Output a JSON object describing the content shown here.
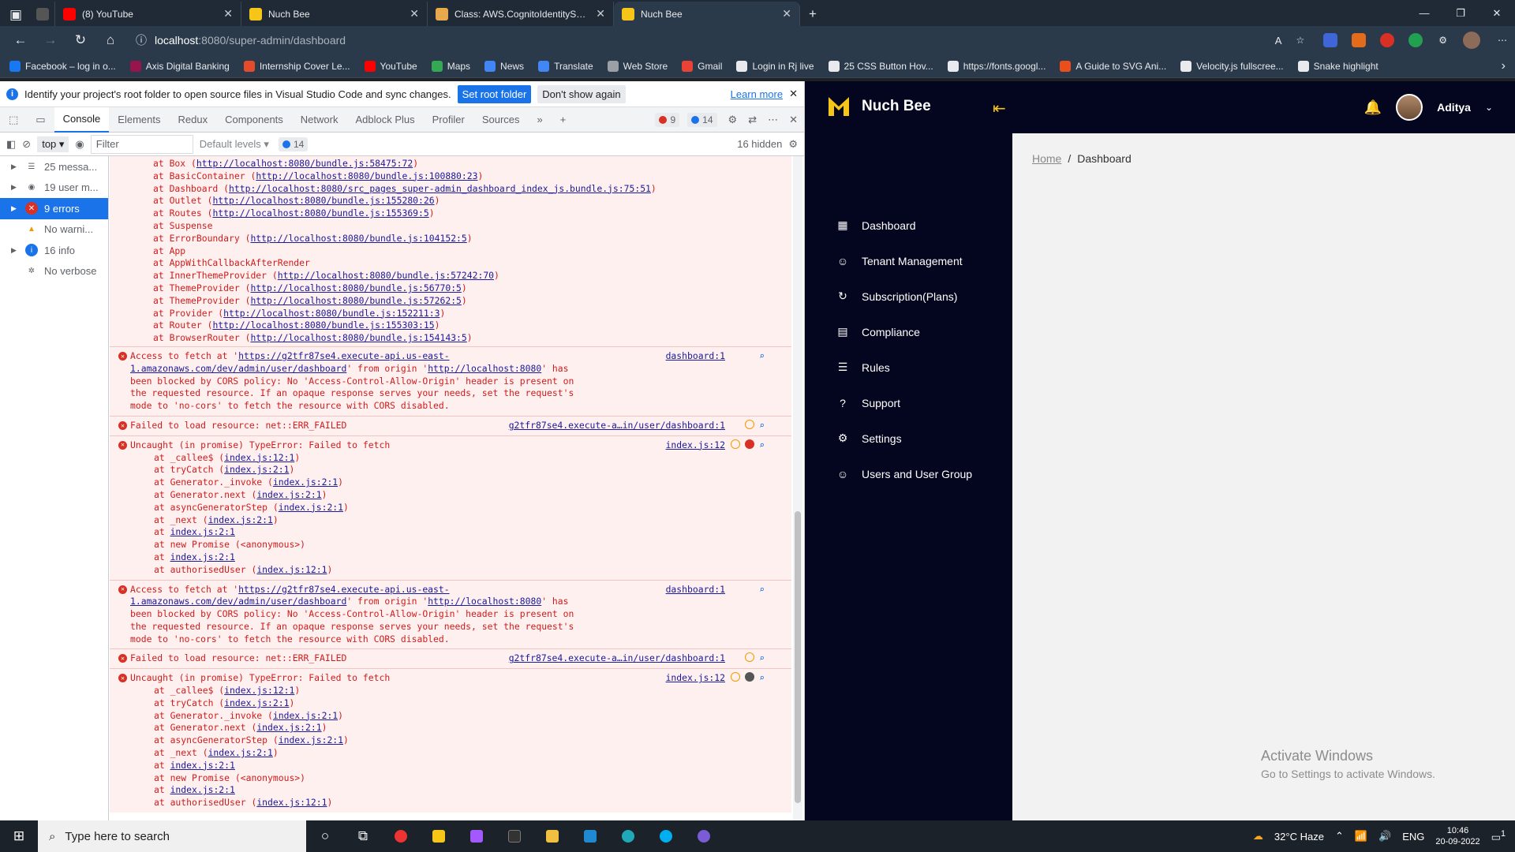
{
  "browser": {
    "tabs": [
      {
        "title": "(8) YouTube",
        "active": false
      },
      {
        "title": "Nuch Bee",
        "active": false
      },
      {
        "title": "Class: AWS.CognitoIdentityServi",
        "active": false
      },
      {
        "title": "Nuch Bee",
        "active": true
      }
    ],
    "url_host": "localhost",
    "url_path": ":8080/super-admin/dashboard",
    "bookmarks": [
      "Facebook – log in o...",
      "Axis Digital Banking",
      "Internship Cover Le...",
      "YouTube",
      "Maps",
      "News",
      "Translate",
      "Web Store",
      "Gmail",
      "Login in Rj live",
      "25 CSS Button Hov...",
      "https://fonts.googl...",
      "A Guide to SVG Ani...",
      "Velocity.js fullscree...",
      "Snake highlight"
    ]
  },
  "devtools": {
    "infobar": {
      "text": "Identify your project's root folder to open source files in Visual Studio Code and sync changes.",
      "set_root": "Set root folder",
      "dont_show": "Don't show again",
      "learn_more": "Learn more"
    },
    "tabs": [
      "Console",
      "Elements",
      "Redux",
      "Components",
      "Network",
      "Adblock Plus",
      "Profiler",
      "Sources"
    ],
    "error_count": "9",
    "info_count": "14",
    "context": "top",
    "filter_placeholder": "Filter",
    "levels": "Default levels",
    "msg_badge": "14",
    "hidden": "16 hidden",
    "sidebar": [
      {
        "label": "25 messa...",
        "icon": "list-icon"
      },
      {
        "label": "19 user m...",
        "icon": "user-icon"
      },
      {
        "label": "9 errors",
        "icon": "error-icon"
      },
      {
        "label": "No warni...",
        "icon": "warning-icon"
      },
      {
        "label": "16 info",
        "icon": "info-icon"
      },
      {
        "label": "No verbose",
        "icon": "bug-icon"
      }
    ],
    "top_stack": [
      [
        "at Box (",
        "http://localhost:8080/bundle.js:58475:72",
        ")"
      ],
      [
        "at BasicContainer (",
        "http://localhost:8080/bundle.js:100880:23",
        ")"
      ],
      [
        "at Dashboard (",
        "http://localhost:8080/src_pages_super-admin_dashboard_index_js.bundle.js:75:51",
        ")"
      ],
      [
        "at Outlet (",
        "http://localhost:8080/bundle.js:155280:26",
        ")"
      ],
      [
        "at Routes (",
        "http://localhost:8080/bundle.js:155369:5",
        ")"
      ],
      [
        "at Suspense",
        "",
        ""
      ],
      [
        "at ErrorBoundary (",
        "http://localhost:8080/bundle.js:104152:5",
        ")"
      ],
      [
        "at App",
        "",
        ""
      ],
      [
        "at AppWithCallbackAfterRender",
        "",
        ""
      ],
      [
        "at InnerThemeProvider (",
        "http://localhost:8080/bundle.js:57242:70",
        ")"
      ],
      [
        "at ThemeProvider (",
        "http://localhost:8080/bundle.js:56770:5",
        ")"
      ],
      [
        "at ThemeProvider (",
        "http://localhost:8080/bundle.js:57262:5",
        ")"
      ],
      [
        "at Provider (",
        "http://localhost:8080/bundle.js:152211:3",
        ")"
      ],
      [
        "at Router (",
        "http://localhost:8080/bundle.js:155303:15",
        ")"
      ],
      [
        "at BrowserRouter (",
        "http://localhost:8080/bundle.js:154143:5",
        ")"
      ]
    ],
    "cors_msg": {
      "pre": "Access to fetch at '",
      "url": "https://g2tfr87se4.execute-api.us-east-1.amazonaws.com/dev/admin/user/dashboard",
      "mid": "' from origin '",
      "origin": "http://localhost:8080",
      "post": "' has been blocked by CORS policy: No 'Access-Control-Allow-Origin' header is present on the requested resource. If an opaque response serves your needs, set the request's mode to 'no-cors' to fetch the resource with CORS disabled.",
      "src": "dashboard:1"
    },
    "failed_msg": {
      "text": "Failed to load resource: net::ERR_FAILED",
      "src": "g2tfr87se4.execute-a…in/user/dashboard:1"
    },
    "uncaught_msg": {
      "text": "Uncaught (in promise) TypeError: Failed to fetch",
      "src": "index.js:12",
      "stack": [
        [
          "at _callee$ (",
          "index.js:12:1",
          ")"
        ],
        [
          "at tryCatch (",
          "index.js:2:1",
          ")"
        ],
        [
          "at Generator._invoke (",
          "index.js:2:1",
          ")"
        ],
        [
          "at Generator.next (",
          "index.js:2:1",
          ")"
        ],
        [
          "at asyncGeneratorStep (",
          "index.js:2:1",
          ")"
        ],
        [
          "at _next (",
          "index.js:2:1",
          ")"
        ],
        [
          "at ",
          "index.js:2:1",
          ""
        ],
        [
          "at new Promise (<anonymous>)",
          "",
          ""
        ],
        [
          "at ",
          "index.js:2:1",
          ""
        ],
        [
          "at authorisedUser (",
          "index.js:12:1",
          ")"
        ]
      ]
    }
  },
  "app": {
    "brand": "Nuch Bee",
    "user": "Aditya",
    "menu": [
      {
        "label": "Dashboard",
        "icon": "grid-icon"
      },
      {
        "label": "Tenant Management",
        "icon": "users-icon"
      },
      {
        "label": "Subscription(Plans)",
        "icon": "subscription-icon"
      },
      {
        "label": "Compliance",
        "icon": "clipboard-icon"
      },
      {
        "label": "Rules",
        "icon": "list-icon"
      },
      {
        "label": "Support",
        "icon": "help-icon"
      },
      {
        "label": "Settings",
        "icon": "gear-icon"
      },
      {
        "label": "Users and User Group",
        "icon": "users-icon"
      }
    ],
    "breadcrumb_home": "Home",
    "breadcrumb_sep": "/",
    "breadcrumb_current": "Dashboard",
    "watermark_title": "Activate Windows",
    "watermark_sub": "Go to Settings to activate Windows."
  },
  "taskbar": {
    "search_placeholder": "Type here to search",
    "weather": "32°C  Haze",
    "lang": "ENG",
    "time": "10:46",
    "date": "20-09-2022",
    "notif": "1"
  },
  "colors": {
    "accent": "#f5c518",
    "sidebar_bg": "#04061f",
    "devtools_blue": "#1a73e8",
    "error_red": "#d01c1c"
  }
}
